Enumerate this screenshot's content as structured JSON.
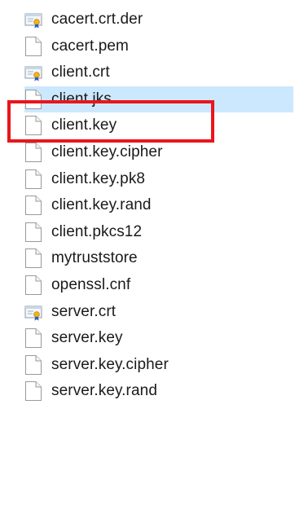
{
  "files": [
    {
      "name": "cacert.crt.der",
      "icon": "certificate-icon"
    },
    {
      "name": "cacert.pem",
      "icon": "file-icon"
    },
    {
      "name": "client.crt",
      "icon": "certificate-icon"
    },
    {
      "name": "client.jks",
      "icon": "file-icon",
      "selected": true
    },
    {
      "name": "client.key",
      "icon": "file-icon"
    },
    {
      "name": "client.key.cipher",
      "icon": "file-icon"
    },
    {
      "name": "client.key.pk8",
      "icon": "file-icon"
    },
    {
      "name": "client.key.rand",
      "icon": "file-icon"
    },
    {
      "name": "client.pkcs12",
      "icon": "file-icon"
    },
    {
      "name": "mytruststore",
      "icon": "file-icon"
    },
    {
      "name": "openssl.cnf",
      "icon": "file-icon"
    },
    {
      "name": "server.crt",
      "icon": "certificate-icon"
    },
    {
      "name": "server.key",
      "icon": "file-icon"
    },
    {
      "name": "server.key.cipher",
      "icon": "file-icon"
    },
    {
      "name": "server.key.rand",
      "icon": "file-icon"
    }
  ],
  "colors": {
    "selection": "#cce8ff",
    "highlight_border": "#e8161b",
    "text": "#1a1a1a"
  }
}
